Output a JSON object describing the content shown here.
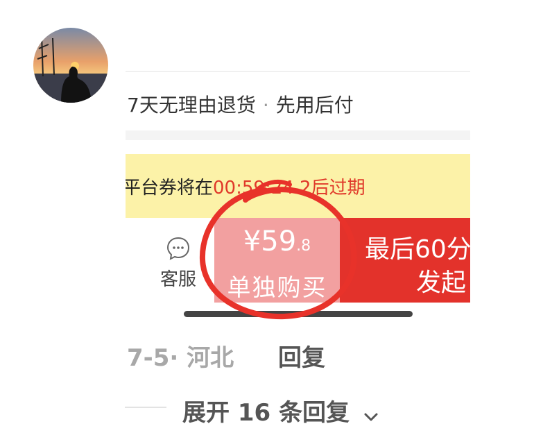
{
  "comment": {
    "location_meta": "7-5· 河北",
    "reply_label": "回复",
    "expand_label": "展开 16 条回复"
  },
  "screenshot": {
    "policy_left": "7天无理由退货",
    "policy_dot": "·",
    "policy_right": "先用后付",
    "coupon_prefix": "平台券将在",
    "coupon_time": "00:59:24.2",
    "coupon_suffix": "后过期",
    "service_label": "客服",
    "solo_price_symbol": "¥",
    "solo_price_int": "59",
    "solo_price_dec": ".8",
    "solo_buy_label": "单独购买",
    "group_line1": "最后60分",
    "group_line2": "发起"
  },
  "colors": {
    "coupon_bg": "#fcf2a8",
    "coupon_time": "#e0392a",
    "solo_bg": "#f2a0a0",
    "group_bg": "#e3322b",
    "annotation": "#e8322a"
  },
  "icons": {
    "avatar": "sunset-avatar",
    "service": "chat-bubble-icon",
    "expand": "chevron-down-icon"
  }
}
